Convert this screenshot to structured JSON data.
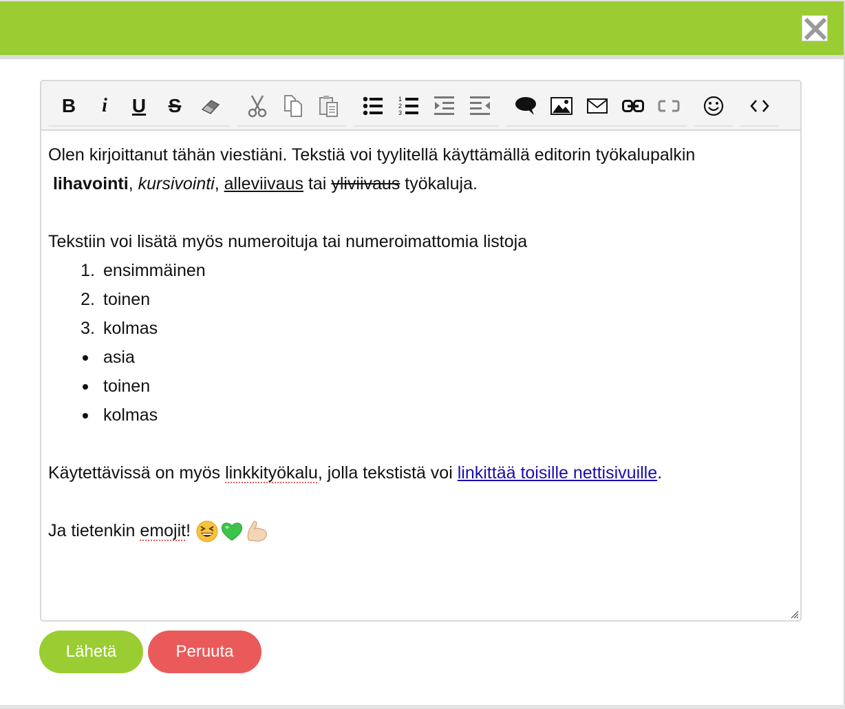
{
  "colors": {
    "accent": "#9acd32",
    "cancel": "#eb5a5a",
    "link": "#1a0dab"
  },
  "dialog": {
    "close_icon": "close-icon"
  },
  "toolbar": {
    "groups": [
      [
        "bold",
        "italic",
        "underline",
        "strikethrough",
        "eraser"
      ],
      [
        "cut",
        "copy",
        "paste"
      ],
      [
        "bulleted-list",
        "numbered-list",
        "indent",
        "outdent"
      ],
      [
        "speech-bubble",
        "image",
        "mail",
        "link",
        "unlink"
      ],
      [
        "emoji"
      ],
      [
        "source-code"
      ]
    ],
    "labels": {
      "bold": "B",
      "italic": "i",
      "underline": "U",
      "strike": "S"
    }
  },
  "content": {
    "p1_text": "Olen kirjoittanut tähän viestiäni. Tekstiä voi tyylitellä käyttämällä editorin työkalupalkin",
    "p1_bold": "lihavointi",
    "sep1": ",",
    "p1_italic": "kursivointi",
    "sep2": ",",
    "p1_underline": "alleviivaus",
    "p1_tai": "tai",
    "p1_strike": "yliviivaus",
    "p1_end": "työkaluja.",
    "p2": "Tekstiin voi lisätä myös numeroituja tai numeroimattomia listoja",
    "ordered": [
      {
        "num": "1.",
        "text": "ensimmäinen"
      },
      {
        "num": "2.",
        "text": "toinen"
      },
      {
        "num": "3.",
        "text": "kolmas"
      }
    ],
    "unordered": [
      "asia",
      "toinen",
      "kolmas"
    ],
    "p3_start": "Käytettävissä on myös",
    "p3_spell": "linkkityökalu",
    "p3_mid": ", jolla tekstistä voi",
    "p3_link": "linkittää toisille nettisivuille",
    "p3_end": ".",
    "p4_start": "Ja tietenkin",
    "p4_spell": "emojit",
    "p4_end": "!",
    "emojis": [
      "grinning-squinting-face",
      "green-heart",
      "flexed-biceps"
    ]
  },
  "buttons": {
    "send": "Lähetä",
    "cancel": "Peruuta"
  }
}
